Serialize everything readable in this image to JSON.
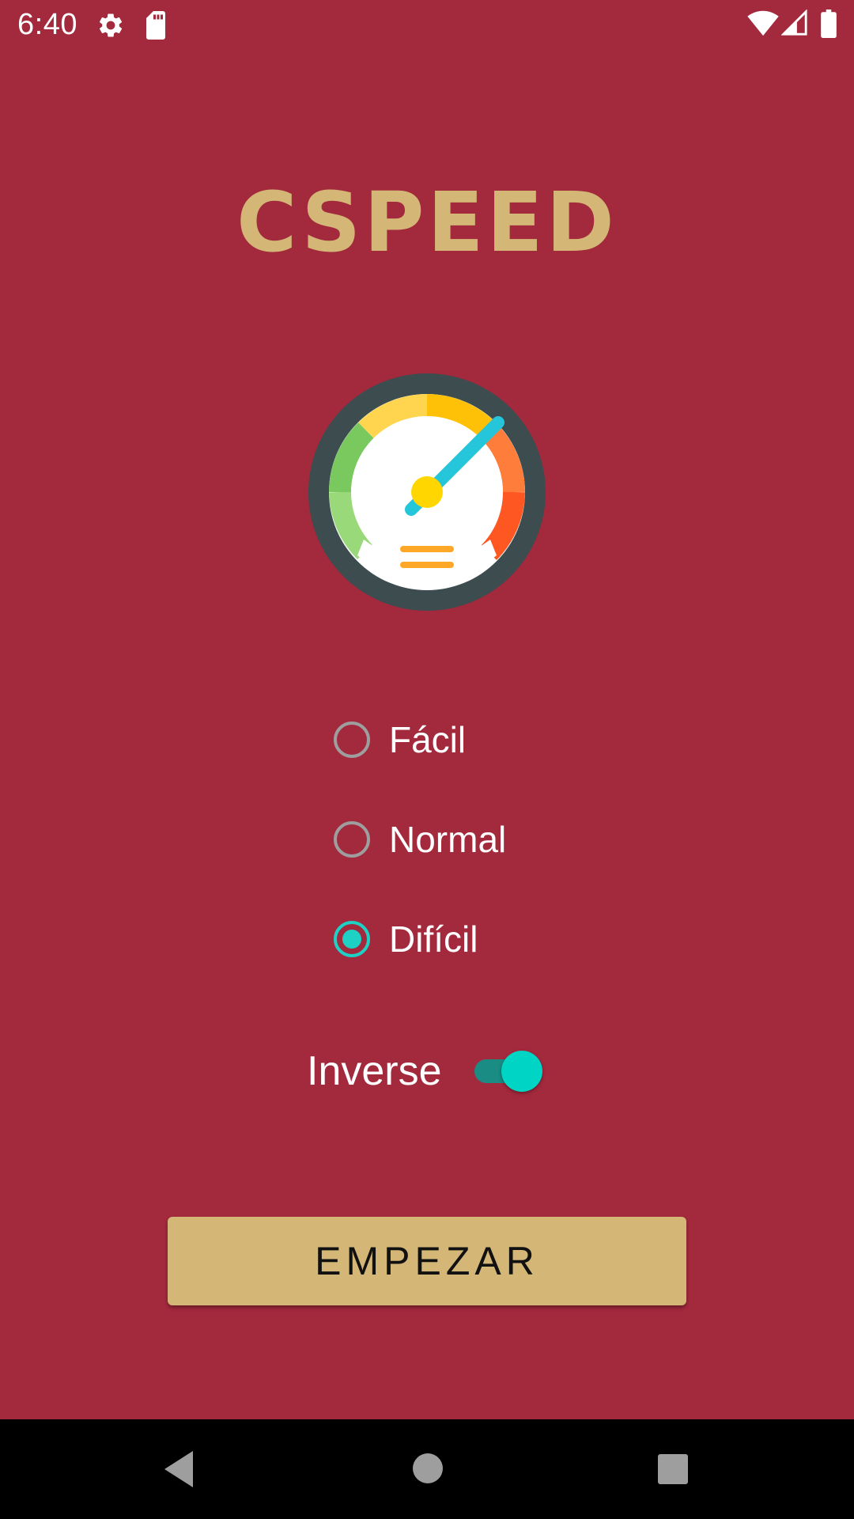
{
  "status_bar": {
    "time": "6:40",
    "icons": [
      "settings-icon",
      "sd-card-icon",
      "wifi-icon",
      "signal-icon",
      "battery-icon"
    ]
  },
  "app": {
    "title": "CSPEED",
    "logo_icon": "speedometer-icon"
  },
  "difficulty": {
    "options": [
      {
        "label": "Fácil",
        "checked": false
      },
      {
        "label": "Normal",
        "checked": false
      },
      {
        "label": "Difícil",
        "checked": true
      }
    ]
  },
  "inverse": {
    "label": "Inverse",
    "enabled": true
  },
  "start_button": {
    "label": "EMPEZAR"
  },
  "nav_bar": {
    "icons": [
      "back-icon",
      "home-icon",
      "recents-icon"
    ]
  },
  "colors": {
    "background": "#a3293d",
    "accent_gold": "#d4b776",
    "accent_teal": "#1fd0c4"
  }
}
